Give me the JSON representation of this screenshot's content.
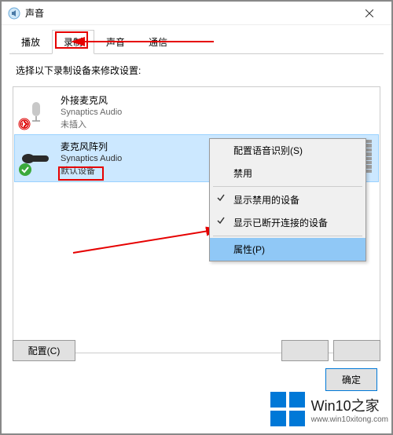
{
  "window": {
    "title": "声音"
  },
  "tabs": {
    "playback": "播放",
    "recording": "录制",
    "sounds": "声音",
    "communications": "通信"
  },
  "instruction": "选择以下录制设备来修改设置:",
  "devices": [
    {
      "name": "外接麦克风",
      "driver": "Synaptics Audio",
      "status": "未插入"
    },
    {
      "name": "麦克风阵列",
      "driver": "Synaptics Audio",
      "status": "默认设备"
    }
  ],
  "context_menu": {
    "configure_speech": "配置语音识别(S)",
    "disable": "禁用",
    "show_disabled": "显示禁用的设备",
    "show_disconnected": "显示已断开连接的设备",
    "properties": "属性(P)"
  },
  "buttons": {
    "configure": "配置(C)",
    "ok": "确定"
  },
  "watermark": {
    "title": "Win10之家",
    "url": "www.win10xitong.com"
  }
}
